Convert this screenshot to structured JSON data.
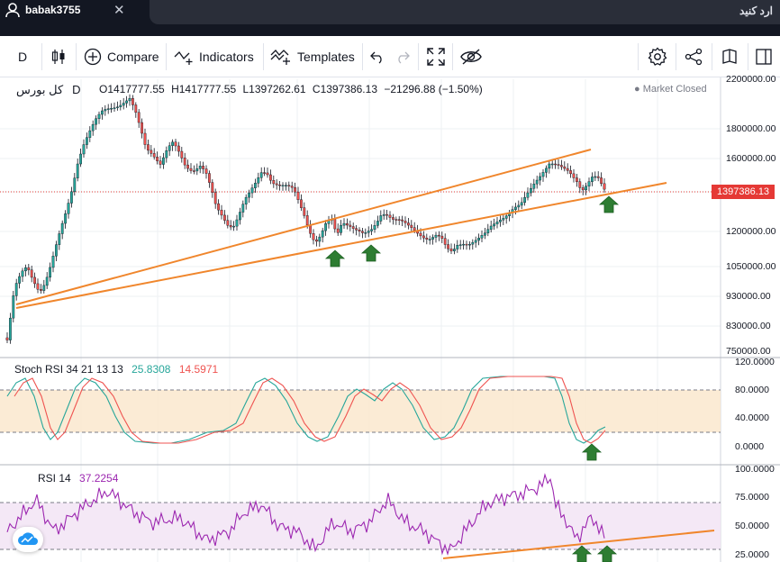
{
  "topbar": {
    "username": "babak3755",
    "search_placeholder": "ارد کنید"
  },
  "toolbar": {
    "interval": "D",
    "compare": "Compare",
    "indicators": "Indicators",
    "templates": "Templates"
  },
  "symbol": {
    "name": "کل بورس",
    "interval": "D",
    "open": "O1417777.55",
    "high": "H1417777.55",
    "low": "L1397262.61",
    "close": "C1397386.13",
    "change": "−21296.88 (−1.50%)",
    "status": "Market Closed",
    "last_price": "1397386.13"
  },
  "price_axis": [
    "2200000.00",
    "1800000.00",
    "1600000.00",
    "1400000.00",
    "1200000.00",
    "1050000.00",
    "930000.00",
    "830000.00",
    "750000.00"
  ],
  "stoch": {
    "title": "Stoch RSI 34 21 13 13",
    "k": "25.8308",
    "d": "14.5971",
    "axis": [
      "120.0000",
      "80.0000",
      "40.0000",
      "0.0000"
    ]
  },
  "rsi": {
    "title": "RSI 14",
    "value": "37.2254",
    "axis": [
      "100.0000",
      "75.0000",
      "50.0000",
      "25.0000"
    ]
  },
  "colors": {
    "up": "#26a69a",
    "down": "#ef5350",
    "trend": "#f0862c",
    "arrow": "#2e7d32",
    "stoch_k": "#26a69a",
    "stoch_d": "#ef5350",
    "rsi": "#9c27b0"
  }
}
